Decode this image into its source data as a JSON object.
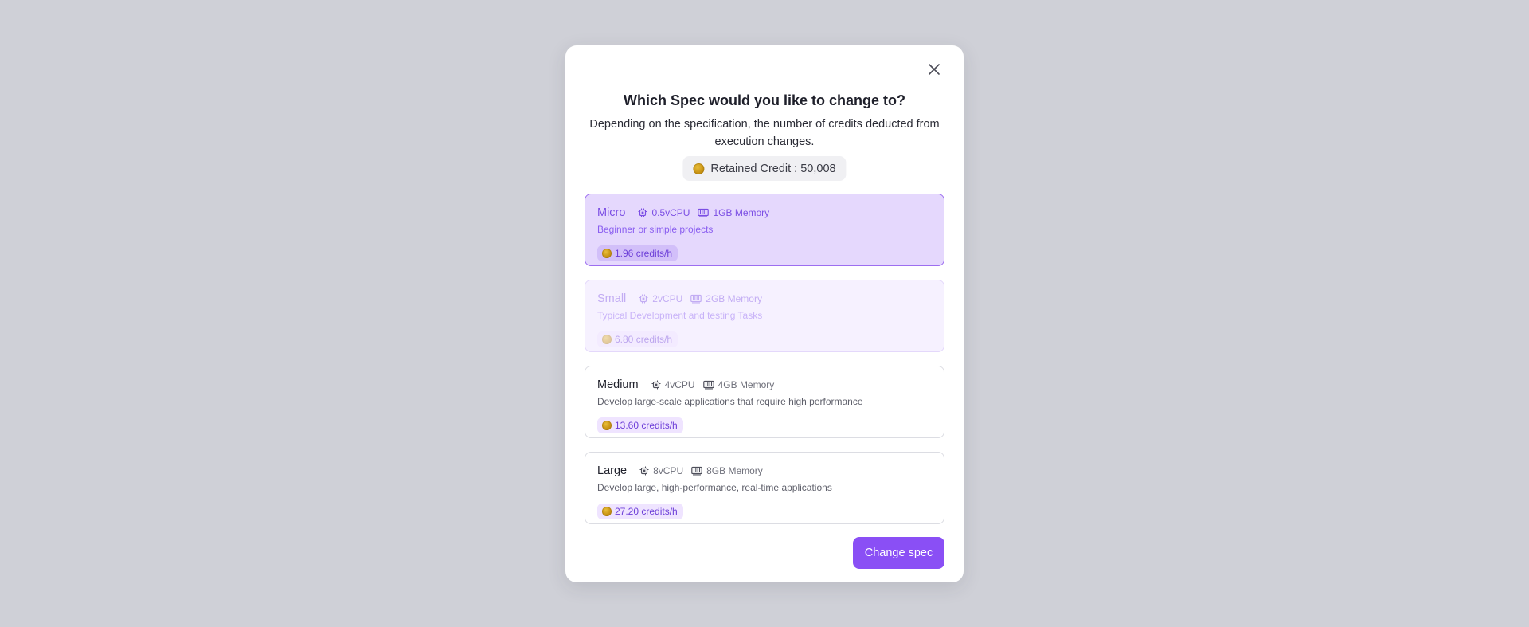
{
  "modal": {
    "title": "Which Spec would you like to change to?",
    "subtitle": "Depending on the specification, the number of credits deducted from execution changes.",
    "credit_label": "Retained Credit : 50,008",
    "close_icon": "close-icon",
    "confirm_label": "Change spec"
  },
  "specs": [
    {
      "name": "Micro",
      "cpu": "0.5vCPU",
      "memory": "1GB Memory",
      "description": "Beginner or simple projects",
      "rate": "1.96 credits/h",
      "state": "selected"
    },
    {
      "name": "Small",
      "cpu": "2vCPU",
      "memory": "2GB Memory",
      "description": "Typical Development and testing Tasks",
      "rate": "6.80 credits/h",
      "state": "disabled"
    },
    {
      "name": "Medium",
      "cpu": "4vCPU",
      "memory": "4GB Memory",
      "description": "Develop large-scale applications that require high performance",
      "rate": "13.60 credits/h",
      "state": "default"
    },
    {
      "name": "Large",
      "cpu": "8vCPU",
      "memory": "8GB Memory",
      "description": "Develop large, high-performance, real-time applications",
      "rate": "27.20 credits/h",
      "state": "default"
    }
  ],
  "colors": {
    "accent": "#8a4ff5",
    "selected_bg": "#e5d8fd",
    "overlay_bg": "#cfd0d7"
  },
  "icons": {
    "cpu": "cpu-chip-icon",
    "memory": "memory-icon",
    "credit": "coin-icon"
  }
}
